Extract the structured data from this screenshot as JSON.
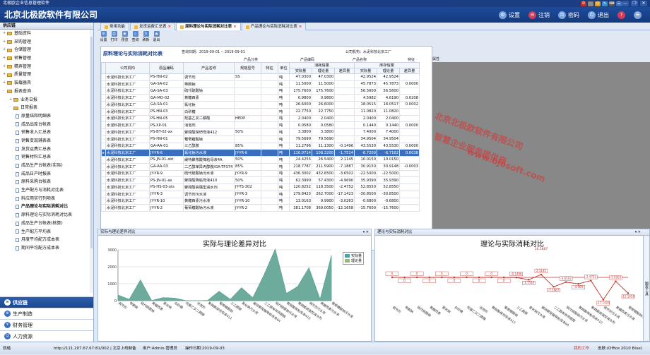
{
  "title_bar": {
    "text": "北极欧企业信息管理软件",
    "buttons": [
      "—",
      "❐",
      "✕"
    ],
    "tray": [
      "中",
      "·",
      "☺",
      "✎",
      "⌨",
      "☰"
    ]
  },
  "header": {
    "app_name": "北京北极欧软件有限公司",
    "actions": [
      {
        "label": "设置",
        "icon": "gear-icon",
        "glyph": "⚙"
      },
      {
        "label": "注销",
        "icon": "lock-icon",
        "glyph": "⊖"
      },
      {
        "label": "密码",
        "icon": "key-icon",
        "glyph": "⚿"
      },
      {
        "label": "退出",
        "icon": "power-icon",
        "glyph": "⏻"
      }
    ],
    "help_glyph": "?"
  },
  "sidebar": {
    "title": "供应链",
    "items": [
      {
        "label": "基础资料",
        "level": 0,
        "type": "folder",
        "exp": "+"
      },
      {
        "label": "采购管理",
        "level": 0,
        "type": "folder",
        "exp": "+"
      },
      {
        "label": "仓储管理",
        "level": 0,
        "type": "folder",
        "exp": "+"
      },
      {
        "label": "销售管理",
        "level": 0,
        "type": "folder",
        "exp": "+"
      },
      {
        "label": "精弄管理",
        "level": 0,
        "type": "folder",
        "exp": "+"
      },
      {
        "label": "质量管理",
        "level": 0,
        "type": "folder",
        "exp": "+"
      },
      {
        "label": "装载器具",
        "level": 0,
        "type": "folder",
        "exp": "+"
      },
      {
        "label": "报表查询",
        "level": 0,
        "type": "folder",
        "exp": "-"
      },
      {
        "label": "业务日报",
        "level": 1,
        "type": "folder",
        "exp": "+"
      },
      {
        "label": "日常报表",
        "level": 1,
        "type": "folder",
        "exp": "-"
      },
      {
        "label": "原量结和明细表",
        "level": 2,
        "type": "doc"
      },
      {
        "label": "成品出库台帐表",
        "level": 2,
        "type": "doc"
      },
      {
        "label": "销售收入汇总表",
        "level": 2,
        "type": "doc"
      },
      {
        "label": "销售变现辅表表",
        "level": 2,
        "type": "doc"
      },
      {
        "label": "发货运费汇总表",
        "level": 2,
        "type": "doc"
      },
      {
        "label": "销售材料汇总表",
        "level": 2,
        "type": "doc"
      },
      {
        "label": "成品生产台帐表(实际)",
        "level": 2,
        "type": "doc"
      },
      {
        "label": "成品日产时报表",
        "level": 2,
        "type": "doc"
      },
      {
        "label": "原料采购台帐表",
        "level": 2,
        "type": "doc"
      },
      {
        "label": "生产配方与消耗对比表",
        "level": 2,
        "type": "doc"
      },
      {
        "label": "料应用实行列项表",
        "level": 2,
        "type": "doc"
      },
      {
        "label": "产品理论与实际消耗对比",
        "level": 2,
        "type": "doc",
        "selected": true
      },
      {
        "label": "原料理论与实际消耗对比表",
        "level": 2,
        "type": "doc"
      },
      {
        "label": "成品生产台帐表(核算)",
        "level": 2,
        "type": "doc"
      },
      {
        "label": "生产配方平均表",
        "level": 2,
        "type": "doc"
      },
      {
        "label": "月度平均配方成本表",
        "level": 2,
        "type": "doc"
      },
      {
        "label": "期间平均配方成本表",
        "level": 2,
        "type": "doc"
      }
    ],
    "modules": [
      {
        "label": "供应链",
        "glyph": "≡",
        "active": true
      },
      {
        "label": "生产制造",
        "glyph": "⚙",
        "active": false
      },
      {
        "label": "财务管理",
        "glyph": "¥",
        "active": false
      },
      {
        "label": "人力资源",
        "glyph": "☺",
        "active": false
      }
    ]
  },
  "tabs": [
    {
      "label": "常用功能",
      "active": false,
      "close": ""
    },
    {
      "label": "发货运费汇总表",
      "active": false,
      "close": "×"
    },
    {
      "label": "原料理论与实际消耗对比表",
      "active": true,
      "close": "×"
    },
    {
      "label": "产品理论与实际消耗对比表",
      "active": false,
      "close": "×"
    }
  ],
  "toolbar": [
    {
      "label": "设置",
      "glyph": "⚙"
    },
    {
      "label": "打印",
      "glyph": "⎙"
    },
    {
      "label": "预览",
      "glyph": "◉"
    },
    {
      "label": "查询",
      "glyph": "⌕"
    },
    {
      "label": "刷新",
      "glyph": "↻"
    },
    {
      "label": "退出",
      "glyph": "⏏"
    }
  ],
  "report": {
    "title": "原料理论与实际消耗对比表",
    "date_range": "查询日期：2019-09-01 -- 2019-09-01",
    "company": "公司机构：水泥科技北京工厂",
    "col_category": "产品分类",
    "col_code": "产品编码",
    "col_name": "产品名称",
    "col_spec": "特征",
    "col_attr": "属性",
    "headers_top": [
      "",
      "公司机构",
      "原品编码",
      "产品名称",
      "规格型号",
      "特征",
      "单位",
      "消耗信量",
      "库存信量"
    ],
    "headers_sub": [
      "实际量",
      "理论量",
      "差异量",
      "实际量",
      "理论量",
      "差异量"
    ],
    "rows": [
      [
        "",
        "水泥科技北京工厂",
        "PS-HN-02",
        "调节剂",
        "SS",
        "",
        "吨",
        "47.0300",
        "47.0300",
        "",
        "42.9524",
        "42.9524",
        ""
      ],
      [
        "",
        "水泥科技北京工厂",
        "GA-SA-02",
        "带腕钠",
        "",
        "",
        "吨",
        "11.5000",
        "11.5000",
        "",
        "45.7873",
        "45.7873",
        "0.0000"
      ],
      [
        "",
        "水泥科技北京工厂",
        "GA-SA-03",
        "硫代硫酸钠",
        "",
        "",
        "吨",
        "175.7600",
        "175.7600",
        "",
        "56.5600",
        "56.5600",
        ""
      ],
      [
        "",
        "水泥科技北京工厂",
        "GA-MO-02",
        "黄糖西素",
        "",
        "",
        "吨",
        "0.9800",
        "0.9800",
        "",
        "4.5982",
        "4.6190",
        "0.0208"
      ],
      [
        "",
        "水泥科技北京工厂",
        "GA-SA-01",
        "氯化钠",
        "",
        "",
        "吨",
        "26.6000",
        "26.6000",
        "",
        "18.0515",
        "18.0517",
        "0.0002"
      ],
      [
        "",
        "水泥科技北京工厂",
        "PS-HN-03",
        "白砂糖",
        "",
        "",
        "吨",
        "22.7750",
        "22.7750",
        "",
        "11.0820",
        "11.0820",
        ""
      ],
      [
        "",
        "水泥科技北京工厂",
        "PS-HN-05",
        "羟基乙叉二膦酸",
        "HEDP",
        "",
        "吨",
        "2.0400",
        "2.0400",
        "",
        "2.0400",
        "2.0400",
        ""
      ],
      [
        "",
        "水泥科技北京工厂",
        "PS-XP-01",
        "消泡剂",
        "",
        "",
        "吨",
        "0.0580",
        "0.0580",
        "",
        "0.1440",
        "0.1440",
        "0.0000"
      ],
      [
        "",
        "水泥科技北京工厂",
        "PS-BT-02-ax",
        "聚羧酸保坍母液412",
        "50%",
        "",
        "吨",
        "3.3800",
        "3.3800",
        "",
        "7.4000",
        "7.4000",
        ""
      ],
      [
        "",
        "水泥科技北京工厂",
        "PS-HN-01",
        "葡萄糖酸钠",
        "",
        "",
        "吨",
        "79.5690",
        "79.5690",
        "",
        "34.9504",
        "34.9504",
        ""
      ],
      [
        "",
        "水泥科技北京工厂",
        "GA-AA-01",
        "三乙醇胺",
        "85%",
        "",
        "吨",
        "11.2796",
        "11.1300",
        "-0.1496",
        "43.5530",
        "43.5530",
        "0.0000"
      ],
      [
        "▸",
        "水泥科技北京工厂",
        "JY-YR-6",
        "氯化钠污水液",
        "JY-YR-6",
        "",
        "吨",
        "110.0714",
        "108.3200",
        "-1.7514",
        "-6.7200",
        "-6.7162",
        "0.0038"
      ],
      [
        "",
        "水泥科技北京工厂",
        "PS-JN-01-sbt",
        "缓特聚羧酸降粘母液4A",
        "50%",
        "",
        "吨",
        "24.4255",
        "26.5400",
        "2.1145",
        "10.0150",
        "10.0150",
        ""
      ],
      [
        "",
        "水泥科技北京工厂",
        "GA-AA-03",
        "二乙醇单异丙醇胺/GA-TP374",
        "85%",
        "",
        "吨",
        "218.7787",
        "211.5900",
        "-7.1887",
        "30.9150",
        "30.9148",
        "-0.0003"
      ],
      [
        "",
        "水泥科技北京工厂",
        "JY-YR-9",
        "硫代硫酸钠污水液",
        "JY-YR-9",
        "",
        "吨",
        "436.3002",
        "432.6500",
        "-3.6502",
        "-22.5000",
        "-22.5000",
        ""
      ],
      [
        "",
        "水泥科技北京工厂",
        "PS-JN-01-ax",
        "聚羧酸降粘母液410",
        "50%",
        "",
        "吨",
        "62.3990",
        "57.4300",
        "-4.9690",
        "35.9390",
        "35.9390",
        ""
      ],
      [
        "",
        "水泥科技北京工厂",
        "PS-HS-03-ots",
        "聚羧酸高强型减水剂",
        "JY-TS-302",
        "",
        "吨",
        "120.8252",
        "118.3500",
        "-2.4752",
        "52.8550",
        "52.8550",
        ""
      ],
      [
        "",
        "水泥科技北京工厂",
        "JY-YR-3",
        "调节剂污水液",
        "JY-YR-3",
        "",
        "吨",
        "279.8423",
        "262.7000",
        "-17.1423",
        "-30.8500",
        "-30.8500",
        ""
      ],
      [
        "",
        "水泥科技北京工厂",
        "JY-YR-10",
        "黄糖西素污水液",
        "JY-YR-10",
        "",
        "吨",
        "13.0163",
        "9.9900",
        "-3.0263",
        "-0.6800",
        "-0.6800",
        ""
      ],
      [
        "",
        "水泥科技北京工厂",
        "JY-YR-2",
        "葡萄糖酸钠污水液",
        "JY-YR-2",
        "",
        "吨",
        "381.1708",
        "369.0050",
        "-12.1658",
        "-15.7600",
        "-15.7600",
        ""
      ]
    ]
  },
  "watermark": {
    "line1": "北京北极欧软件有限公司",
    "line2": "智慧企业服务提供商",
    "url": "www.bjosoft.com"
  },
  "chart_left": {
    "panel_title": "实际与理论差异对比",
    "pin": "▾ ✕"
  },
  "chart_right": {
    "panel_title": "理论与实际消耗对比",
    "pin": "▾ ✕",
    "side_strip": "图表工具"
  },
  "chart_data": [
    {
      "type": "area",
      "title": "实际与理论差异对比",
      "categories": [
        "调节剂",
        "带腕钠",
        "硫代硫酸钠",
        "黄糖西素",
        "氯化钠",
        "白砂糖",
        "羟基乙叉二膦酸",
        "消泡剂",
        "聚羧酸保坍母液412",
        "葡萄糖酸钠",
        "三乙醇胺",
        "氯化钠污水液",
        "缓特聚羧酸降粘母液4A",
        "二乙醇单异丙醇胺",
        "硫代硫酸钠污水液",
        "聚羧酸降粘母液410",
        "聚羧酸高强型减水剂",
        "调节剂污水液",
        "黄糖西素污水液",
        "葡萄糖酸钠污水液"
      ],
      "series": [
        {
          "name": "实际量",
          "color": "#55a0a0",
          "values": [
            47,
            11,
            175,
            1,
            26,
            22,
            2,
            0,
            3,
            79,
            11,
            110,
            24,
            218,
            436,
            62,
            120,
            279,
            13,
            381
          ]
        },
        {
          "name": "理论量",
          "color": "#9aba72",
          "values": [
            47,
            11,
            175,
            1,
            26,
            22,
            2,
            0,
            3,
            79,
            11,
            108,
            26,
            211,
            432,
            57,
            118,
            262,
            10,
            369
          ]
        }
      ],
      "ylim": [
        0,
        3000
      ],
      "yticks": [
        0,
        1000,
        2000,
        3000
      ],
      "legend": "top-right"
    },
    {
      "type": "line",
      "title": "理论与实际消耗对比",
      "categories": [
        "调节剂",
        "带腕钠",
        "硫代硫酸钠",
        "黄糖西素",
        "氯化钠",
        "白砂糖",
        "羟基乙叉二膦酸",
        "消泡剂",
        "聚羧酸保坍母液412",
        "葡萄糖酸钠",
        "三乙醇胺",
        "氯化钠污水液",
        "缓特聚羧酸降粘母液4A",
        "二乙醇单异丙醇胺",
        "硫代硫酸钠污水液",
        "聚羧酸降粘母液410",
        "聚羧酸高强型减水剂",
        "调节剂污水液",
        "黄糖西素污水液",
        "葡萄糖酸钠污水液"
      ],
      "values": [
        0,
        0,
        0,
        0,
        0,
        0,
        0,
        0,
        0,
        0,
        -0.1496,
        -1.7514,
        2.1145,
        -7.1887,
        -3.6502,
        -4.969,
        -2.4752,
        -17.1423,
        -3.0263,
        -12.1658
      ],
      "labels": [
        "0",
        "0",
        "0",
        "0",
        "0",
        "0",
        "0",
        "0",
        "0",
        "0",
        "-0.1496",
        "-1.7514",
        "2.1145",
        "-7.1887",
        "-3.6502",
        "-4.969",
        "-2.4752",
        "-17.1423",
        "-3.0263",
        "-12.1658"
      ],
      "peak_label": "16.5887",
      "color": "#c0302b",
      "ylim": [
        -20,
        20
      ]
    }
  ],
  "status": {
    "ready": "就绪",
    "server": "http://111.207.67.67:81/002 | 北京上线制备",
    "user": "用户:Admin-管理员",
    "date": "操作日期:2019-09-03",
    "mywork": "我的工作",
    "skin": "皮肤:(Office 2010 Blue)"
  }
}
